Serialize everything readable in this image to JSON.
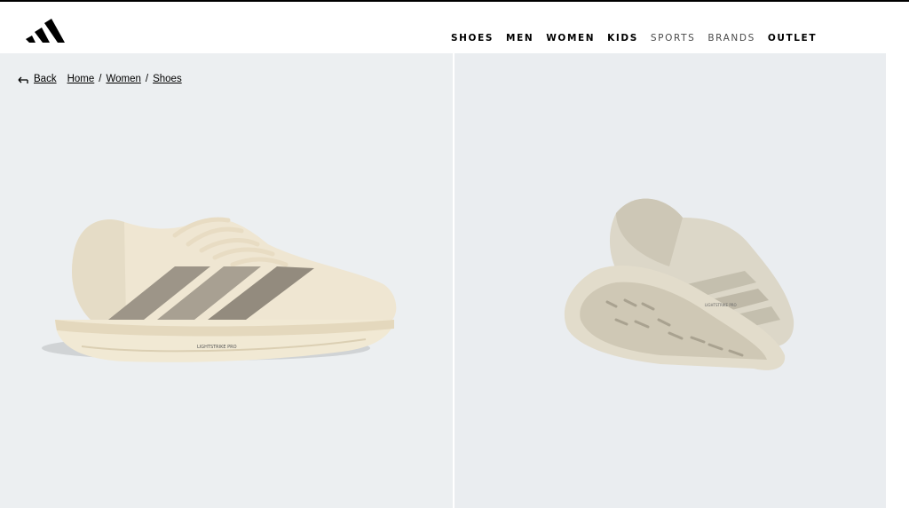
{
  "brand": {
    "logo_icon": "adidas-logo-icon"
  },
  "nav": {
    "items": [
      {
        "label": "SHOES",
        "style": "bold"
      },
      {
        "label": "MEN",
        "style": "bold"
      },
      {
        "label": "WOMEN",
        "style": "bold"
      },
      {
        "label": "KIDS",
        "style": "bold"
      },
      {
        "label": "SPORTS",
        "style": "light"
      },
      {
        "label": "BRANDS",
        "style": "light"
      },
      {
        "label": "OUTLET",
        "style": "bold"
      }
    ]
  },
  "breadcrumb": {
    "back_label": "Back",
    "items": [
      "Home",
      "Women",
      "Shoes"
    ],
    "separator": "/"
  },
  "gallery": {
    "images": [
      {
        "name": "shoe-side-view",
        "sole_text": "LIGHTSTRIKE PRO"
      },
      {
        "name": "shoe-back-angle-view",
        "sole_text": "LIGHTSTRIKE PRO"
      }
    ]
  },
  "colors": {
    "accent": "#000000",
    "panel_bg": "#eceff1",
    "shoe_body": "#efe6d2",
    "stripe": "#9d9588"
  }
}
